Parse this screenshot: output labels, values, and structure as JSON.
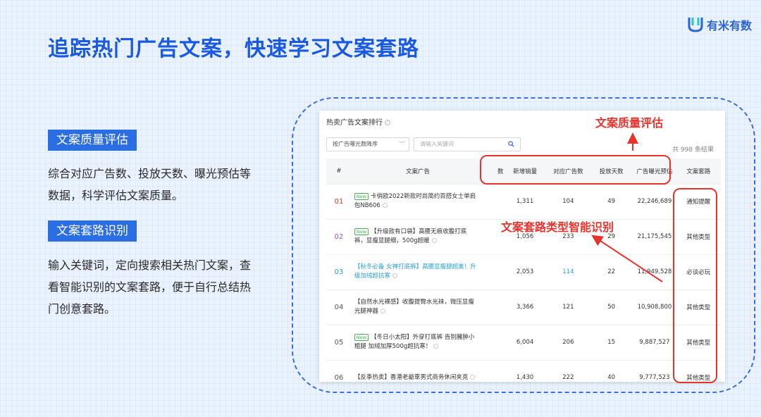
{
  "slide": {
    "title": "追踪热门广告文案，快速学习文案套路",
    "brand": "有米有数"
  },
  "features": [
    {
      "tag": "文案质量评估",
      "desc": "综合对应广告数、投放天数、曝光预估等数据，科学评估文案质量。"
    },
    {
      "tag": "文案套路识别",
      "desc": "输入关键词，定向搜索相关热门文案，查看智能识别的文案套路，便于自行总结热门创意套路。"
    }
  ],
  "panel": {
    "title": "热卖广告文案排行",
    "sort_select": "按广告曝光数降序",
    "search_placeholder": "请输入关键词",
    "total": "共 998 条结果",
    "columns": [
      "#",
      "文案广告",
      "品数",
      "新增销量",
      "对应广告数",
      "投放天数",
      "广告曝光预估",
      "文案套路"
    ],
    "rows": [
      {
        "rank": "01",
        "rank_color": "#e8332c",
        "new": "New",
        "text": "卡俏欧2022新款时尚简约百搭女士单肩包NB606",
        "hl": false,
        "sales": "1,311",
        "ads": "104",
        "days": "49",
        "exposure": "22,246,689",
        "category": "通知提醒"
      },
      {
        "rank": "02",
        "rank_color": "#8a5ad8",
        "new": "New",
        "text": "【升级款有口袋】高腰无痕收腹打底裤，显瘦显腿细，500g超暖",
        "hl": false,
        "sales": "1,056",
        "ads": "233",
        "days": "29",
        "exposure": "21,175,545",
        "category": "其他类型"
      },
      {
        "rank": "03",
        "rank_color": "#2aa0d8",
        "new": "",
        "text": "【秋冬必备 女神打底裤】高腰显瘦腿超美！升级加绒超抗寒",
        "hl": true,
        "sales": "2,053",
        "ads": "114",
        "days": "22",
        "exposure": "11,949,528",
        "category": "必谈必玩"
      },
      {
        "rank": "04",
        "rank_color": "#555555",
        "new": "",
        "text": "【自然水光裸感】收腹提臀水光袜，微压显瘦光腿神器",
        "hl": false,
        "sales": "3,366",
        "ads": "121",
        "days": "50",
        "exposure": "10,908,800",
        "category": "其他类型"
      },
      {
        "rank": "05",
        "rank_color": "#555555",
        "new": "New",
        "text": "【冬日小太阳】外穿打底裤 告别臃肿小粗腿 加绒加厚500g超抗寒！",
        "hl": false,
        "sales": "6,004",
        "ads": "206",
        "days": "15",
        "exposure": "9,887,527",
        "category": "其他类型"
      },
      {
        "rank": "06",
        "rank_color": "#555555",
        "new": "",
        "text": "【反季热卖】香港老爺車男式商务休闲夹克",
        "hl": false,
        "sales": "1,430",
        "ads": "222",
        "days": "40",
        "exposure": "9,777,523",
        "category": "其他类型"
      }
    ]
  },
  "annotations": {
    "quality": "文案质量评估",
    "routine": "文案套路类型智能识别"
  },
  "colors": {
    "accent": "#2b6de2",
    "annotation": "#e8332c",
    "highlight": "#2aa0d8"
  }
}
